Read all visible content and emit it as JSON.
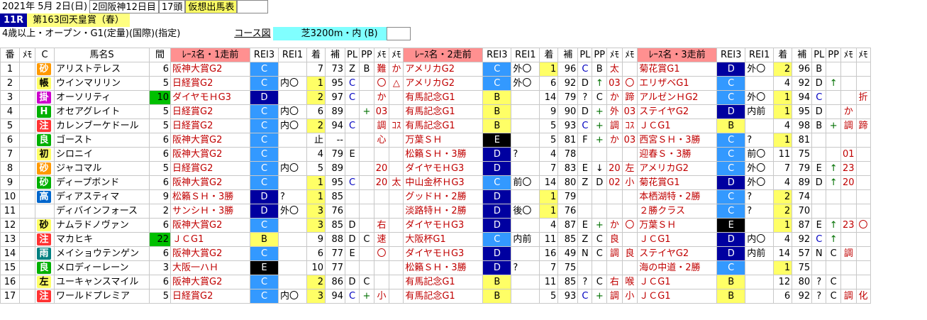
{
  "header": {
    "date": "2021年 5月 2日(日)",
    "venue": "2回阪神12日目",
    "runners": "17頭",
    "status": "仮想出馬表",
    "race_no": "11R",
    "race_title": "第163回天皇賞（春）",
    "conditions": "4歳以上・オープン・G1(定量)(国際)(指定)",
    "course_link": "コース図",
    "distance": "芝3200m・内 (B)"
  },
  "columns": [
    "番",
    "ﾒﾓ",
    "C",
    "馬名S",
    "間",
    "ﾚｰｽ名・1走前",
    "REI3",
    "REI1",
    "着",
    "補",
    "PL",
    "PP",
    "ﾒﾓ",
    "ﾒﾓ",
    "ﾚｰｽ名・2走前",
    "REI3",
    "REI1",
    "着",
    "補",
    "PL",
    "PP",
    "ﾒﾓ",
    "ﾒﾓ",
    "ﾚｰｽ名・3走前",
    "REI3",
    "REI1",
    "着",
    "補",
    "PL",
    "PP",
    "ﾒﾓ",
    "ﾒﾓ"
  ],
  "rows": [
    {
      "no": "1",
      "style": "砂",
      "sc": "s-orange",
      "name": "アリストテレス",
      "gap": "6",
      "r1": [
        "阪神大賞G2",
        "C",
        "",
        "7",
        "73",
        "Z",
        "B",
        "難",
        "か"
      ],
      "r2": [
        "アメリカG2",
        "C",
        "外〇",
        "1",
        "96",
        "C",
        "B",
        "太",
        ""
      ],
      "r3": [
        "菊花賞G1",
        "D",
        "外〇",
        "2",
        "96",
        "B",
        "",
        "",
        ""
      ]
    },
    {
      "no": "2",
      "style": "帳",
      "sc": "s-yellow",
      "name": "ウインマリリン",
      "gap": "5",
      "r1": [
        "日経賞G2",
        "C",
        "内〇",
        "1",
        "95",
        "C",
        "",
        "〇",
        "△"
      ],
      "r2": [
        "アメリカG2",
        "C",
        "外〇",
        "6",
        "92",
        "D",
        "↑",
        "03",
        "〇"
      ],
      "r3": [
        "エリザベG1",
        "C",
        "",
        "4",
        "92",
        "D",
        "↑",
        "",
        ""
      ]
    },
    {
      "no": "3",
      "style": "掛",
      "sc": "s-purple",
      "name": "オーソリティ",
      "gap": "10",
      "r1": [
        "ダイヤモＨG3",
        "D",
        "",
        "2",
        "97",
        "C",
        "",
        "か",
        ""
      ],
      "r2": [
        "有馬記念G1",
        "B",
        "",
        "14",
        "79",
        "?",
        "C",
        "か",
        "蹄"
      ],
      "r3": [
        "アルゼンＨG2",
        "C",
        "外〇",
        "1",
        "94",
        "C",
        "",
        "",
        "折"
      ]
    },
    {
      "no": "4",
      "style": "H",
      "sc": "s-green",
      "name": "オセアグレイト",
      "gap": "5",
      "r1": [
        "日経賞G2",
        "C",
        "内〇",
        "6",
        "89",
        "",
        "+",
        "03",
        ""
      ],
      "r2": [
        "有馬記念G1",
        "B",
        "",
        "9",
        "90",
        "D",
        "+",
        "外",
        "03"
      ],
      "r3": [
        "ステイヤG2",
        "D",
        "内前",
        "1",
        "95",
        "D",
        "",
        "か",
        ""
      ]
    },
    {
      "no": "5",
      "style": "注",
      "sc": "s-red",
      "name": "カレンブーケドール",
      "gap": "5",
      "r1": [
        "日経賞G2",
        "C",
        "内〇",
        "2",
        "94",
        "C",
        "",
        "調",
        "ｺｽ"
      ],
      "r2": [
        "有馬記念G1",
        "B",
        "",
        "5",
        "93",
        "C",
        "+",
        "調",
        "ｺｽ"
      ],
      "r3": [
        "ＪＣG1",
        "B",
        "",
        "4",
        "98",
        "B",
        "+",
        "調",
        "蹄"
      ]
    },
    {
      "no": "6",
      "style": "良",
      "sc": "s-green",
      "name": "ゴースト",
      "gap": "6",
      "r1": [
        "阪神大賞G2",
        "C",
        "",
        "止",
        "--",
        "",
        "",
        "心",
        ""
      ],
      "r2": [
        "万葉ＳＨ",
        "E",
        "",
        "5",
        "81",
        "F",
        "+",
        "か",
        "03"
      ],
      "r3": [
        "西宮ＳＨ・3勝",
        "C",
        "?",
        "1",
        "81",
        "",
        "",
        "",
        ""
      ]
    },
    {
      "no": "7",
      "style": "初",
      "sc": "s-yellow",
      "name": "シロニイ",
      "gap": "6",
      "r1": [
        "阪神大賞G2",
        "C",
        "",
        "4",
        "79",
        "E",
        "",
        "",
        ""
      ],
      "r2": [
        "松籟ＳＨ・3勝",
        "D",
        "?",
        "4",
        "78",
        "",
        "",
        "",
        ""
      ],
      "r3": [
        "迎春Ｓ・3勝",
        "C",
        "前〇",
        "11",
        "75",
        "",
        "",
        "01",
        ""
      ]
    },
    {
      "no": "8",
      "style": "砂",
      "sc": "s-orange",
      "name": "ジャコマル",
      "gap": "5",
      "r1": [
        "日経賞G2",
        "C",
        "内〇",
        "5",
        "89",
        "",
        "",
        "20",
        ""
      ],
      "r2": [
        "ダイヤモＨG3",
        "D",
        "",
        "7",
        "83",
        "E",
        "↓",
        "20",
        "左"
      ],
      "r3": [
        "アメリカG2",
        "C",
        "外〇",
        "7",
        "79",
        "E",
        "↑",
        "23",
        ""
      ]
    },
    {
      "no": "9",
      "style": "砂",
      "sc": "s-green",
      "name": "ディープボンド",
      "gap": "6",
      "r1": [
        "阪神大賞G2",
        "C",
        "",
        "1",
        "95",
        "C",
        "",
        "20",
        "太"
      ],
      "r2": [
        "中山金杯ＨG3",
        "C",
        "前〇",
        "14",
        "80",
        "Z",
        "D",
        "02",
        "小"
      ],
      "r3": [
        "菊花賞G1",
        "D",
        "外〇",
        "4",
        "89",
        "D",
        "↑",
        "20",
        ""
      ]
    },
    {
      "no": "10",
      "style": "高",
      "sc": "s-blue",
      "name": "ディアスティマ",
      "gap": "9",
      "r1": [
        "松籟ＳＨ・3勝",
        "D",
        "?",
        "1",
        "85",
        "",
        "",
        "",
        ""
      ],
      "r2": [
        "グッドＨ・2勝",
        "D",
        "",
        "1",
        "79",
        "",
        "",
        "",
        ""
      ],
      "r3": [
        "本栖湖特・2勝",
        "C",
        "?",
        "2",
        "74",
        "",
        "",
        "",
        ""
      ]
    },
    {
      "no": "11",
      "style": "",
      "sc": "",
      "name": "ディバインフォース",
      "gap": "2",
      "r1": [
        "サンシＨ・3勝",
        "D",
        "外〇",
        "3",
        "76",
        "",
        "",
        "",
        ""
      ],
      "r2": [
        "淡路特Ｈ・2勝",
        "D",
        "後〇",
        "1",
        "76",
        "",
        "",
        "",
        ""
      ],
      "r3": [
        "２勝クラス",
        "C",
        "?",
        "2",
        "70",
        "",
        "",
        "",
        ""
      ]
    },
    {
      "no": "12",
      "style": "砂",
      "sc": "s-yellow",
      "name": "ナムラドノヴァン",
      "gap": "6",
      "r1": [
        "阪神大賞G2",
        "C",
        "",
        "3",
        "85",
        "D",
        "",
        "右",
        ""
      ],
      "r2": [
        "ダイヤモＨG3",
        "D",
        "",
        "4",
        "87",
        "E",
        "+",
        "か",
        "〇"
      ],
      "r3": [
        "万葉ＳＨ",
        "E",
        "",
        "1",
        "87",
        "E",
        "↑",
        "23",
        "〇"
      ]
    },
    {
      "no": "13",
      "style": "注",
      "sc": "s-red",
      "name": "マカヒキ",
      "gap": "22",
      "r1": [
        "ＪＣG1",
        "B",
        "",
        "9",
        "88",
        "D",
        "C",
        "速",
        ""
      ],
      "r2": [
        "大阪杯G1",
        "C",
        "内前",
        "11",
        "85",
        "Z",
        "C",
        "良",
        ""
      ],
      "r3": [
        "ＪＣG1",
        "D",
        "内〇",
        "4",
        "92",
        "C",
        "↑",
        "",
        ""
      ]
    },
    {
      "no": "14",
      "style": "雨",
      "sc": "s-teal",
      "name": "メイショウテンゲン",
      "gap": "6",
      "r1": [
        "阪神大賞G2",
        "C",
        "",
        "6",
        "77",
        "E",
        "",
        "〇",
        ""
      ],
      "r2": [
        "ダイヤモＨG3",
        "D",
        "",
        "16",
        "49",
        "N",
        "C",
        "調",
        "良"
      ],
      "r3": [
        "ステイヤG2",
        "D",
        "内前",
        "14",
        "57",
        "N",
        "C",
        "調",
        ""
      ]
    },
    {
      "no": "15",
      "style": "良",
      "sc": "s-green",
      "name": "メロディーレーン",
      "gap": "3",
      "r1": [
        "大阪一ハＨ",
        "E",
        "",
        "10",
        "77",
        "",
        "",
        "",
        ""
      ],
      "r2": [
        "松籟ＳＨ・3勝",
        "D",
        "?",
        "7",
        "75",
        "",
        "",
        "",
        ""
      ],
      "r3": [
        "海の中道・2勝",
        "C",
        "",
        "1",
        "75",
        "",
        "",
        "",
        ""
      ]
    },
    {
      "no": "16",
      "style": "左",
      "sc": "s-yellow",
      "name": "ユーキャンスマイル",
      "gap": "6",
      "r1": [
        "阪神大賞G2",
        "C",
        "",
        "2",
        "86",
        "D",
        "C",
        "",
        ""
      ],
      "r2": [
        "有馬記念G1",
        "B",
        "",
        "11",
        "85",
        "?",
        "C",
        "右",
        "喉"
      ],
      "r3": [
        "ＪＣG1",
        "B",
        "",
        "12",
        "80",
        "?",
        "C",
        "",
        ""
      ]
    },
    {
      "no": "17",
      "style": "注",
      "sc": "s-red",
      "name": "ワールドプレミア",
      "gap": "5",
      "r1": [
        "日経賞G2",
        "C",
        "内〇",
        "3",
        "94",
        "C",
        "+",
        "小",
        ""
      ],
      "r2": [
        "有馬記念G1",
        "B",
        "",
        "5",
        "93",
        "C",
        "+",
        "調",
        "小"
      ],
      "r3": [
        "ＪＣG1",
        "B",
        "",
        "6",
        "92",
        "?",
        "C",
        "調",
        "化"
      ]
    }
  ]
}
